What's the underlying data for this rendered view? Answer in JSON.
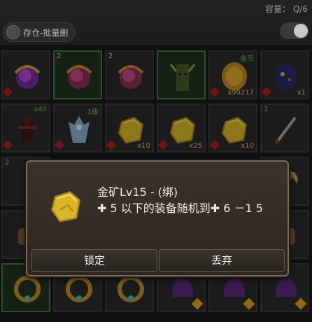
{
  "header": {
    "capacity_label": "容量： Q/6",
    "deposit_button": "存仓-批量删"
  },
  "dialog": {
    "item_name": "金矿Lv15 - (绑)",
    "item_desc": "✚ 5 以下的装备随机到✚ 6 －1 5",
    "lock_button": "锁定",
    "discard_button": "丢弃"
  },
  "slots": [
    {
      "badge": "",
      "qty": "",
      "tag": "",
      "icon": "purple-orb-icon"
    },
    {
      "badge": "2",
      "qty": "",
      "tag": "",
      "icon": "red-orb-icon"
    },
    {
      "badge": "2",
      "qty": "",
      "tag": "",
      "icon": "red-orb-icon"
    },
    {
      "badge": "",
      "qty": "",
      "tag": "",
      "icon": "tree-spirit-icon"
    },
    {
      "badge": "",
      "qty": "x90217",
      "tag": "金币",
      "icon": "gold-coin-icon"
    },
    {
      "badge": "",
      "qty": "x1",
      "tag": "",
      "icon": "dragon-egg-icon"
    },
    {
      "badge": "",
      "qty": "",
      "tag": "x40",
      "icon": "dark-warrior-icon"
    },
    {
      "badge": "",
      "qty": "",
      "tag": "1级",
      "icon": "fox-spirit-icon"
    },
    {
      "badge": "",
      "qty": "x10",
      "tag": "",
      "icon": "gold-ore-icon"
    },
    {
      "badge": "",
      "qty": "x25",
      "tag": "",
      "icon": "gold-ore-icon"
    },
    {
      "badge": "",
      "qty": "x10",
      "tag": "",
      "icon": "gold-ore-icon"
    },
    {
      "badge": "1",
      "qty": "",
      "tag": "",
      "icon": "sword-icon"
    }
  ]
}
